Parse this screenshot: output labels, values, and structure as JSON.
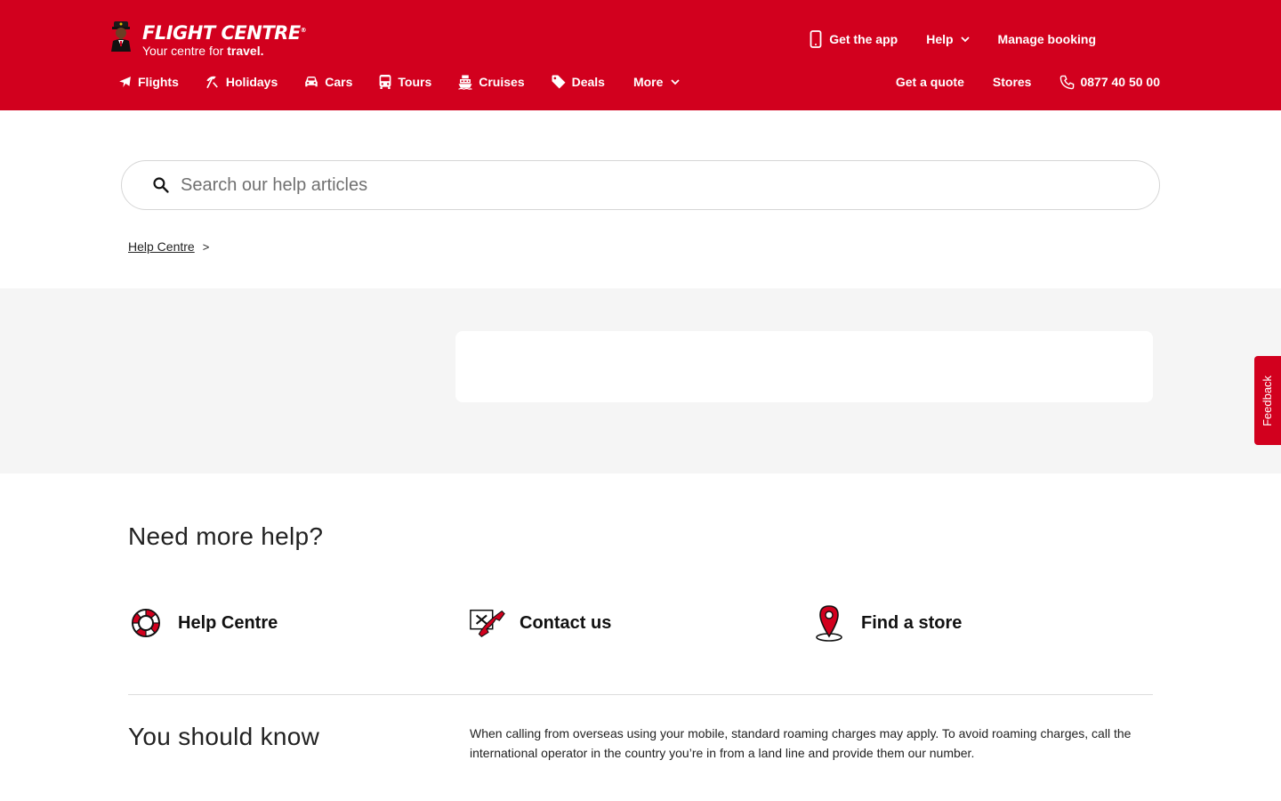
{
  "brand": {
    "name": "FLIGHT CENTRE",
    "registered_mark": "®",
    "tagline_prefix": "Your centre for ",
    "tagline_bold": "travel."
  },
  "utility_nav": {
    "get_app": "Get the app",
    "help": "Help",
    "manage_booking": "Manage booking"
  },
  "main_nav": [
    {
      "label": "Flights",
      "icon": "plane-icon"
    },
    {
      "label": "Holidays",
      "icon": "beach-umbrella-icon"
    },
    {
      "label": "Cars",
      "icon": "car-icon"
    },
    {
      "label": "Tours",
      "icon": "bus-icon"
    },
    {
      "label": "Cruises",
      "icon": "ship-icon"
    },
    {
      "label": "Deals",
      "icon": "tag-icon"
    },
    {
      "label": "More",
      "icon": "chevron-down-icon"
    }
  ],
  "right_nav": {
    "quote": "Get a quote",
    "stores": "Stores",
    "phone": "0877 40 50 00"
  },
  "search": {
    "placeholder": "Search our help articles"
  },
  "breadcrumb": {
    "home": "Help Centre",
    "separator": ">"
  },
  "need_help": {
    "title": "Need more help?",
    "links": [
      {
        "label": "Help Centre",
        "icon": "lifebuoy-icon"
      },
      {
        "label": "Contact us",
        "icon": "phone-plane-icon"
      },
      {
        "label": "Find a store",
        "icon": "map-pin-icon"
      }
    ]
  },
  "you_should_know": {
    "title": "You should know",
    "text": "When calling from overseas using your mobile, standard roaming charges may apply. To avoid roaming charges, call the international operator in the country you’re in from a land line and provide them our number."
  },
  "feedback": {
    "label": "Feedback"
  },
  "colors": {
    "brand_red": "#d2001e",
    "band_grey": "#f5f5f5"
  }
}
